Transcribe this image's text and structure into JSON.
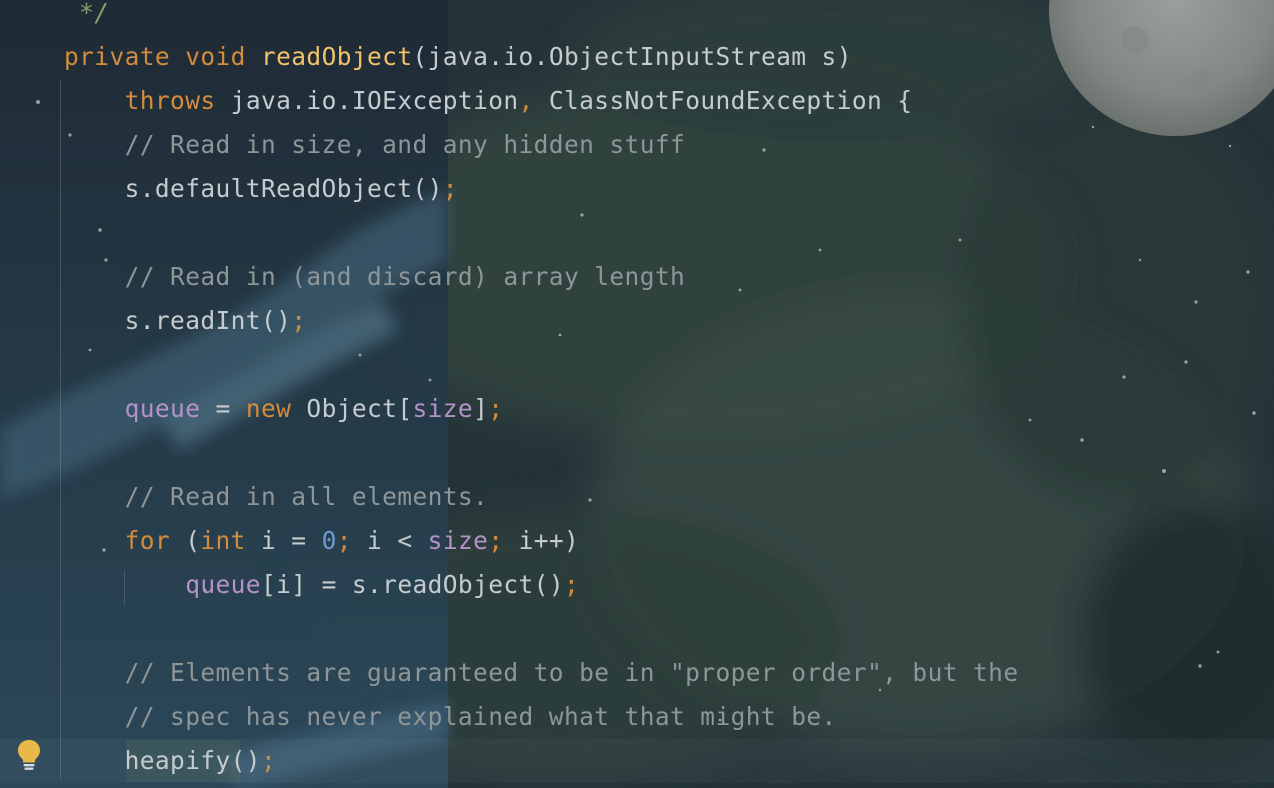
{
  "editor": {
    "lines": [
      [
        {
          "t": " */",
          "c": "doc"
        }
      ],
      [
        {
          "t": "private",
          "c": "kw"
        },
        {
          "t": " ",
          "c": "id"
        },
        {
          "t": "void",
          "c": "kw"
        },
        {
          "t": " ",
          "c": "id"
        },
        {
          "t": "readObject",
          "c": "fn"
        },
        {
          "t": "(java.io.ObjectInputStream s)",
          "c": "id"
        }
      ],
      [
        {
          "t": "    ",
          "c": "id"
        },
        {
          "t": "throws",
          "c": "kw"
        },
        {
          "t": " java.io.IOException",
          "c": "id"
        },
        {
          "t": ",",
          "c": "semi"
        },
        {
          "t": " ClassNotFoundException {",
          "c": "id"
        }
      ],
      [
        {
          "t": "    // Read in size, and any hidden stuff",
          "c": "cmt"
        }
      ],
      [
        {
          "t": "    s.defaultReadObject()",
          "c": "id"
        },
        {
          "t": ";",
          "c": "semi"
        }
      ],
      [],
      [
        {
          "t": "    // Read in (and discard) array length",
          "c": "cmt"
        }
      ],
      [
        {
          "t": "    s.readInt()",
          "c": "id"
        },
        {
          "t": ";",
          "c": "semi"
        }
      ],
      [],
      [
        {
          "t": "    ",
          "c": "id"
        },
        {
          "t": "queue",
          "c": "fld"
        },
        {
          "t": " = ",
          "c": "id"
        },
        {
          "t": "new",
          "c": "kw"
        },
        {
          "t": " Object[",
          "c": "id"
        },
        {
          "t": "size",
          "c": "fld"
        },
        {
          "t": "]",
          "c": "id"
        },
        {
          "t": ";",
          "c": "semi"
        }
      ],
      [],
      [
        {
          "t": "    // Read in all elements.",
          "c": "cmt"
        }
      ],
      [
        {
          "t": "    ",
          "c": "id"
        },
        {
          "t": "for",
          "c": "kw"
        },
        {
          "t": " (",
          "c": "id"
        },
        {
          "t": "int",
          "c": "kw"
        },
        {
          "t": " i = ",
          "c": "id"
        },
        {
          "t": "0",
          "c": "num"
        },
        {
          "t": ";",
          "c": "semi"
        },
        {
          "t": " i < ",
          "c": "id"
        },
        {
          "t": "size",
          "c": "fld"
        },
        {
          "t": ";",
          "c": "semi"
        },
        {
          "t": " i++)",
          "c": "id"
        }
      ],
      [
        {
          "t": "        ",
          "c": "id"
        },
        {
          "t": "queue",
          "c": "fld"
        },
        {
          "t": "[i] = s.readObject()",
          "c": "id"
        },
        {
          "t": ";",
          "c": "semi"
        }
      ],
      [],
      [
        {
          "t": "    // Elements are guaranteed to be in \"proper order\", but the",
          "c": "cmt"
        }
      ],
      [
        {
          "t": "    // spec has never explained what that might be.",
          "c": "cmt"
        }
      ],
      [
        {
          "t": "    heapify()",
          "c": "id"
        },
        {
          "t": ";",
          "c": "semi"
        }
      ]
    ],
    "intention_icon": "lightbulb-icon",
    "colors": {
      "keyword": "#d38b3d",
      "method_declaration": "#f1c26a",
      "identifier": "#c6ccce",
      "comment": "#8e9698",
      "doc_comment": "#7fa36d",
      "field": "#b392c9",
      "number": "#6d9ccc",
      "bulb": "#e8b84a"
    }
  }
}
